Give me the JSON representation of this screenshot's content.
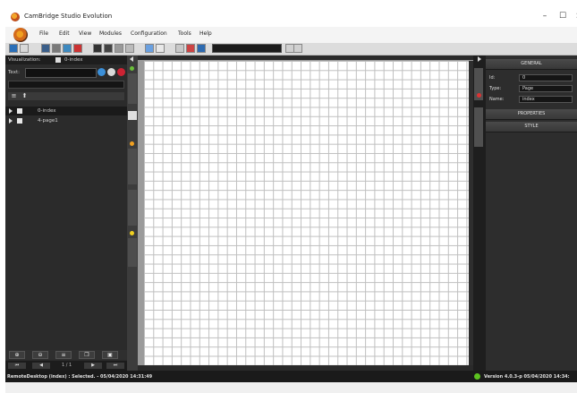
{
  "window": {
    "title": "CamBridge Studio Evolution"
  },
  "menu": {
    "items": [
      "File",
      "Edit",
      "View",
      "Modules",
      "Configuration",
      "Tools",
      "Help"
    ]
  },
  "left_panel": {
    "visualization_label": "Visualization:",
    "visualization_value": "0-index",
    "text_label": "Text:",
    "tree": [
      {
        "label": "0-index",
        "selected": true
      },
      {
        "label": "4-page1",
        "selected": false
      }
    ],
    "pager": {
      "first": "⏮",
      "prev": "◀",
      "text": "1 / 1",
      "next": "▶",
      "last": "⏭"
    }
  },
  "right_panel": {
    "general_header": "GENERAL",
    "fields": [
      {
        "label": "Id:",
        "value": "0"
      },
      {
        "label": "Type:",
        "value": "Page"
      },
      {
        "label": "Name:",
        "value": "index"
      }
    ],
    "properties_header": "PROPERTIES",
    "style_header": "STYLE"
  },
  "status": {
    "left": "RemoteDesktop (index) : Selected. - 05/04/2020 14:31:49",
    "right": "Version 4.0.3-p   05/04/2020 14:34:"
  },
  "colors": {
    "accent_orange": "#d46a1a",
    "status_ok": "#5cc21f",
    "panel_dark": "#2b2b2b"
  }
}
